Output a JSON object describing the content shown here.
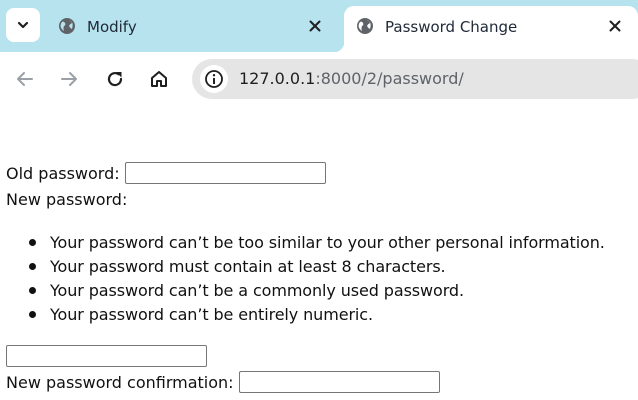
{
  "browser": {
    "tabs": [
      {
        "title": "Modify",
        "active": false
      },
      {
        "title": "Password Change",
        "active": true
      }
    ],
    "address": {
      "host": "127.0.0.1",
      "path": ":8000/2/password/"
    },
    "colors": {
      "tabstrip": "#b6e3ee",
      "omnibox": "#e5e5e5"
    },
    "icons": [
      "chevron-down-icon",
      "globe-icon",
      "close-icon",
      "back-arrow-icon",
      "forward-arrow-icon",
      "reload-icon",
      "home-icon",
      "info-icon"
    ]
  },
  "form": {
    "old_password_label": "Old password:",
    "old_password_value": "",
    "new_password_label": "New password:",
    "help_items": [
      "Your password can’t be too similar to your other personal information.",
      "Your password must contain at least 8 characters.",
      "Your password can’t be a commonly used password.",
      "Your password can’t be entirely numeric."
    ],
    "new_password_value": "",
    "confirmation_label": "New password confirmation:",
    "confirmation_value": ""
  }
}
